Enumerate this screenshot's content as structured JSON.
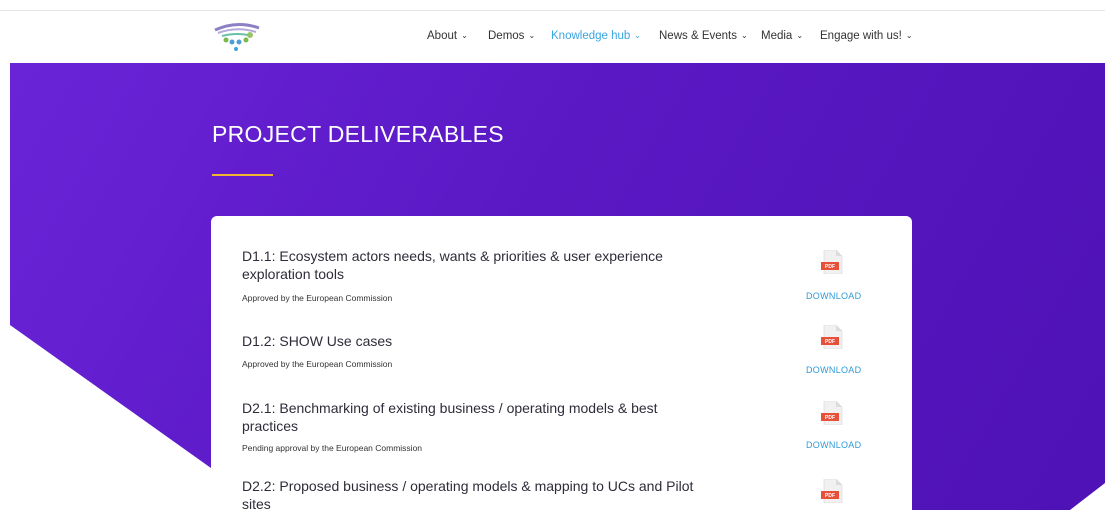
{
  "nav": {
    "items": [
      {
        "label": "About",
        "chevron": "⌄"
      },
      {
        "label": "Demos",
        "chevron": "⌄"
      },
      {
        "label": "Knowledge hub",
        "chevron": "⌄"
      },
      {
        "label": "News & Events",
        "chevron": "⌄"
      },
      {
        "label": "Media",
        "chevron": "⌄"
      },
      {
        "label": "Engage with us!",
        "chevron": "⌄"
      }
    ],
    "active_index": 2
  },
  "hero": {
    "title": "PROJECT DELIVERABLES"
  },
  "deliverables": [
    {
      "title": "D1.1: Ecosystem actors needs, wants & priorities & user experience exploration tools",
      "status": "Approved by the European Commission",
      "download_label": "DOWNLOAD",
      "icon": "pdf-icon"
    },
    {
      "title": "D1.2: SHOW Use cases",
      "status": "Approved by the European Commission",
      "download_label": "DOWNLOAD",
      "icon": "pdf-icon"
    },
    {
      "title": "D2.1: Benchmarking of existing business / operating models & best practices",
      "status": "Pending approval by the European Commission",
      "download_label": "DOWNLOAD",
      "icon": "pdf-icon"
    },
    {
      "title": "D2.2: Proposed business / operating models & mapping to UCs and Pilot sites",
      "status": "",
      "download_label": "",
      "icon": "pdf-icon"
    }
  ],
  "colors": {
    "accent": "#3aa6e0",
    "hero_purple": "#5a18c4",
    "underline_gold": "#f2b731",
    "pdf_red": "#e8503a"
  }
}
